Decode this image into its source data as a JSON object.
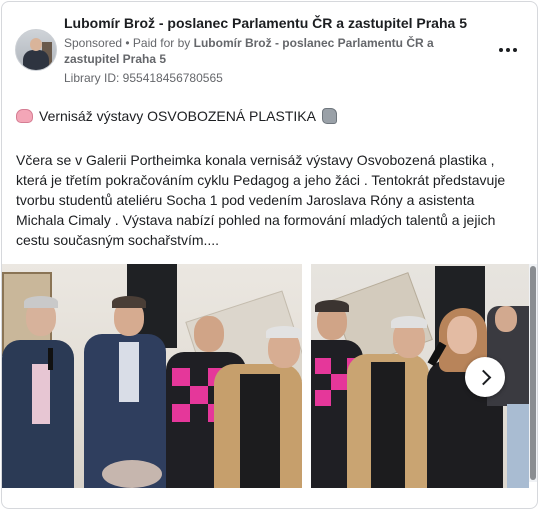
{
  "post": {
    "page_name": "Lubomír Brož - poslanec Parlamentu ČR a zastupitel Praha 5",
    "sponsored_label": "Sponsored",
    "separator": " • ",
    "paid_for_prefix": "Paid for by ",
    "paid_for_by": "Lubomír Brož - poslanec Parlamentu ČR a zastupitel Praha 5",
    "library_id": "Library ID: 955418456780565",
    "more_icon": "more-horizontal-icon",
    "headline": "Vernisáž výstavy OSVOBOZENÁ PLASTIKA",
    "headline_icons": [
      "brain-icon",
      "stone-icon"
    ],
    "body": "Včera se v Galerii Portheimka konala vernisáž výstavy Osvobozená plastika , která je třetím pokračováním cyklu Pedagog a jeho žáci . Tentokrát představuje tvorbu studentů ateliéru Socha 1 pod vedením Jaroslava Róny a asistenta Michala Cimaly . Výstava nabízí pohled na formování mladých talentů a jejich cestu současným sochařstvím...."
  },
  "carousel": {
    "images": [
      {
        "name": "photo-group-men-microphone"
      },
      {
        "name": "photo-woman-speaking-microphone"
      }
    ],
    "next_icon": "chevron-right-icon"
  },
  "colors": {
    "text": "#1c1e21",
    "secondary_text": "#65676b",
    "border": "#d6d8dc",
    "pink_sweater": "#e5379a"
  }
}
